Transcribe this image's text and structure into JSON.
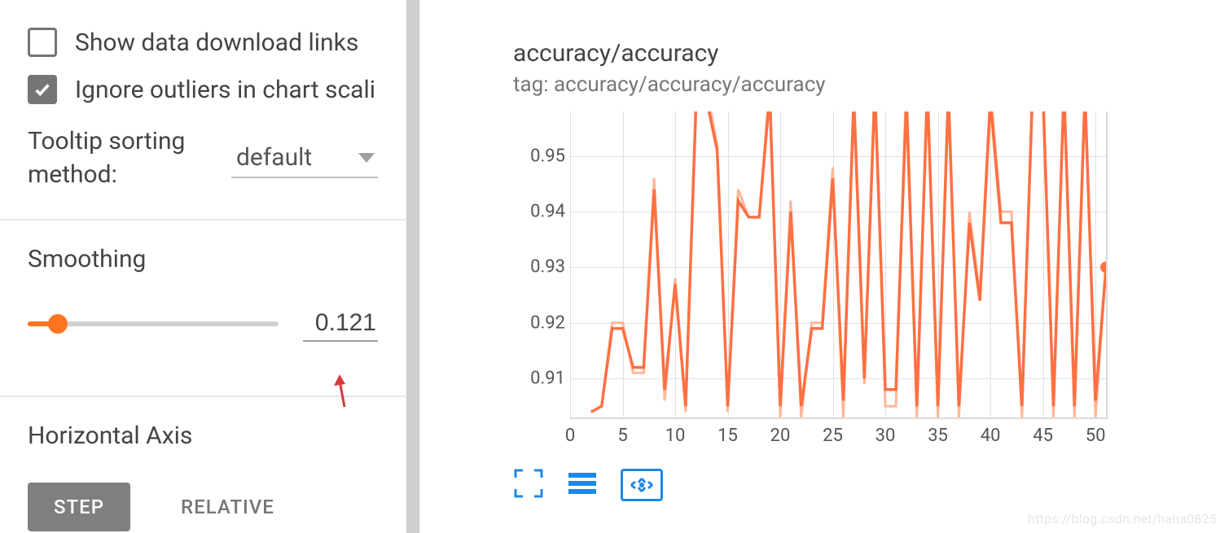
{
  "sidebar": {
    "options": {
      "show_download_links": {
        "label": "Show data download links",
        "checked": false
      },
      "ignore_outliers": {
        "label": "Ignore outliers in chart scali",
        "checked": true
      }
    },
    "tooltip_sorting": {
      "label": "Tooltip sorting method:",
      "value": "default"
    },
    "smoothing": {
      "label": "Smoothing",
      "value": "0.121",
      "fraction": 0.121
    },
    "horizontal_axis": {
      "label": "Horizontal Axis",
      "buttons": {
        "step": "STEP",
        "relative": "RELATIVE"
      },
      "active": "step"
    }
  },
  "chart": {
    "title": "accuracy/accuracy",
    "tag_prefix": "tag: ",
    "tag": "accuracy/accuracy/accuracy",
    "tools": {
      "expand": "expand-icon",
      "lines": "line-mode-icon",
      "fit": "fit-domain-icon"
    },
    "y_ticks": [
      "0.91",
      "0.92",
      "0.93",
      "0.94",
      "0.95"
    ],
    "x_ticks": [
      "0",
      "5",
      "10",
      "15",
      "20",
      "25",
      "30",
      "35",
      "40",
      "45",
      "50"
    ]
  },
  "watermark": "https://blog.csdn.net/haha0825",
  "chart_data": {
    "type": "line",
    "title": "accuracy/accuracy",
    "xlabel": "",
    "ylabel": "",
    "xlim": [
      0,
      51
    ],
    "ylim": [
      0.903,
      0.958
    ],
    "x_ticks": [
      0,
      5,
      10,
      15,
      20,
      25,
      30,
      35,
      40,
      45,
      50
    ],
    "y_ticks": [
      0.91,
      0.92,
      0.93,
      0.94,
      0.95
    ],
    "series": [
      {
        "name": "raw",
        "x": [
          2,
          3,
          4,
          5,
          6,
          7,
          8,
          9,
          10,
          11,
          12,
          13,
          14,
          15,
          16,
          17,
          18,
          19,
          20,
          21,
          22,
          23,
          24,
          25,
          26,
          27,
          28,
          29,
          30,
          31,
          32,
          33,
          34,
          35,
          36,
          37,
          38,
          39,
          40,
          41,
          42,
          43,
          44,
          45,
          46,
          47,
          48,
          49,
          50,
          51
        ],
        "values": [
          0.904,
          0.905,
          0.92,
          0.92,
          0.911,
          0.911,
          0.946,
          0.906,
          0.928,
          0.904,
          0.962,
          0.962,
          0.952,
          0.904,
          0.944,
          0.939,
          0.939,
          0.963,
          0.903,
          0.942,
          0.903,
          0.92,
          0.92,
          0.948,
          0.903,
          0.963,
          0.909,
          0.964,
          0.905,
          0.905,
          0.964,
          0.903,
          0.964,
          0.903,
          0.964,
          0.903,
          0.94,
          0.925,
          0.962,
          0.94,
          0.94,
          0.903,
          0.963,
          0.964,
          0.903,
          0.964,
          0.903,
          0.963,
          0.903,
          0.93
        ]
      },
      {
        "name": "smoothed",
        "x": [
          2,
          3,
          4,
          5,
          6,
          7,
          8,
          9,
          10,
          11,
          12,
          13,
          14,
          15,
          16,
          17,
          18,
          19,
          20,
          21,
          22,
          23,
          24,
          25,
          26,
          27,
          28,
          29,
          30,
          31,
          32,
          33,
          34,
          35,
          36,
          37,
          38,
          39,
          40,
          41,
          42,
          43,
          44,
          45,
          46,
          47,
          48,
          49,
          50,
          51
        ],
        "values": [
          0.904,
          0.905,
          0.919,
          0.919,
          0.912,
          0.912,
          0.944,
          0.908,
          0.927,
          0.905,
          0.96,
          0.96,
          0.951,
          0.905,
          0.942,
          0.939,
          0.939,
          0.961,
          0.905,
          0.94,
          0.905,
          0.919,
          0.919,
          0.946,
          0.906,
          0.96,
          0.91,
          0.962,
          0.908,
          0.908,
          0.96,
          0.905,
          0.962,
          0.905,
          0.961,
          0.905,
          0.938,
          0.924,
          0.96,
          0.938,
          0.938,
          0.905,
          0.961,
          0.961,
          0.905,
          0.962,
          0.905,
          0.961,
          0.906,
          0.93
        ]
      }
    ],
    "legend": false,
    "grid": true,
    "end_marker": {
      "x": 51,
      "y": 0.93
    }
  }
}
